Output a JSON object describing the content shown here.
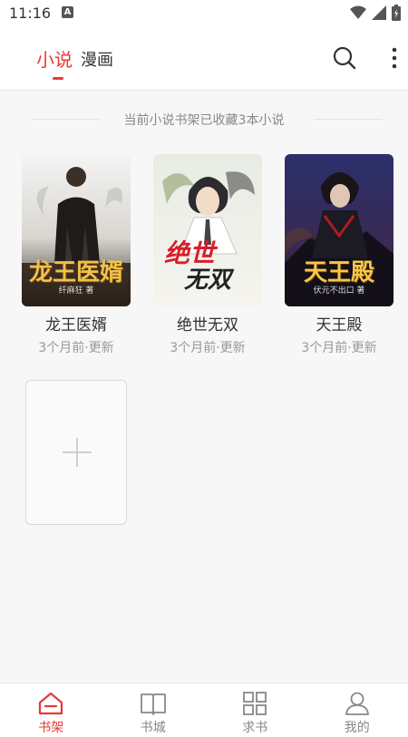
{
  "status_bar": {
    "time": "11:16",
    "notification_badge": "A"
  },
  "header": {
    "tabs": [
      {
        "label": "小说",
        "active": true
      },
      {
        "label": "漫画",
        "active": false
      }
    ],
    "accent_color": "#e53935",
    "icons": [
      "search-icon",
      "more-vert-icon"
    ]
  },
  "shelf": {
    "banner_text": "当前小说书架已收藏3本小说",
    "books": [
      {
        "title": "龙王医婿",
        "updated": "3个月前·更新",
        "cover_text": "龙王医婿",
        "cover_author": "纤麻狂 著"
      },
      {
        "title": "绝世无双",
        "updated": "3个月前·更新",
        "cover_text_top": "绝世",
        "cover_text_bottom": "无双"
      },
      {
        "title": "天王殿",
        "updated": "3个月前·更新",
        "cover_text": "天王殿",
        "cover_author": "伏元不出口 著"
      }
    ],
    "add_icon": "plus-icon"
  },
  "bottom_nav": {
    "items": [
      {
        "label": "书架",
        "icon": "home-icon",
        "active": true
      },
      {
        "label": "书城",
        "icon": "book-icon",
        "active": false
      },
      {
        "label": "求书",
        "icon": "grid-icon",
        "active": false
      },
      {
        "label": "我的",
        "icon": "person-icon",
        "active": false
      }
    ]
  }
}
